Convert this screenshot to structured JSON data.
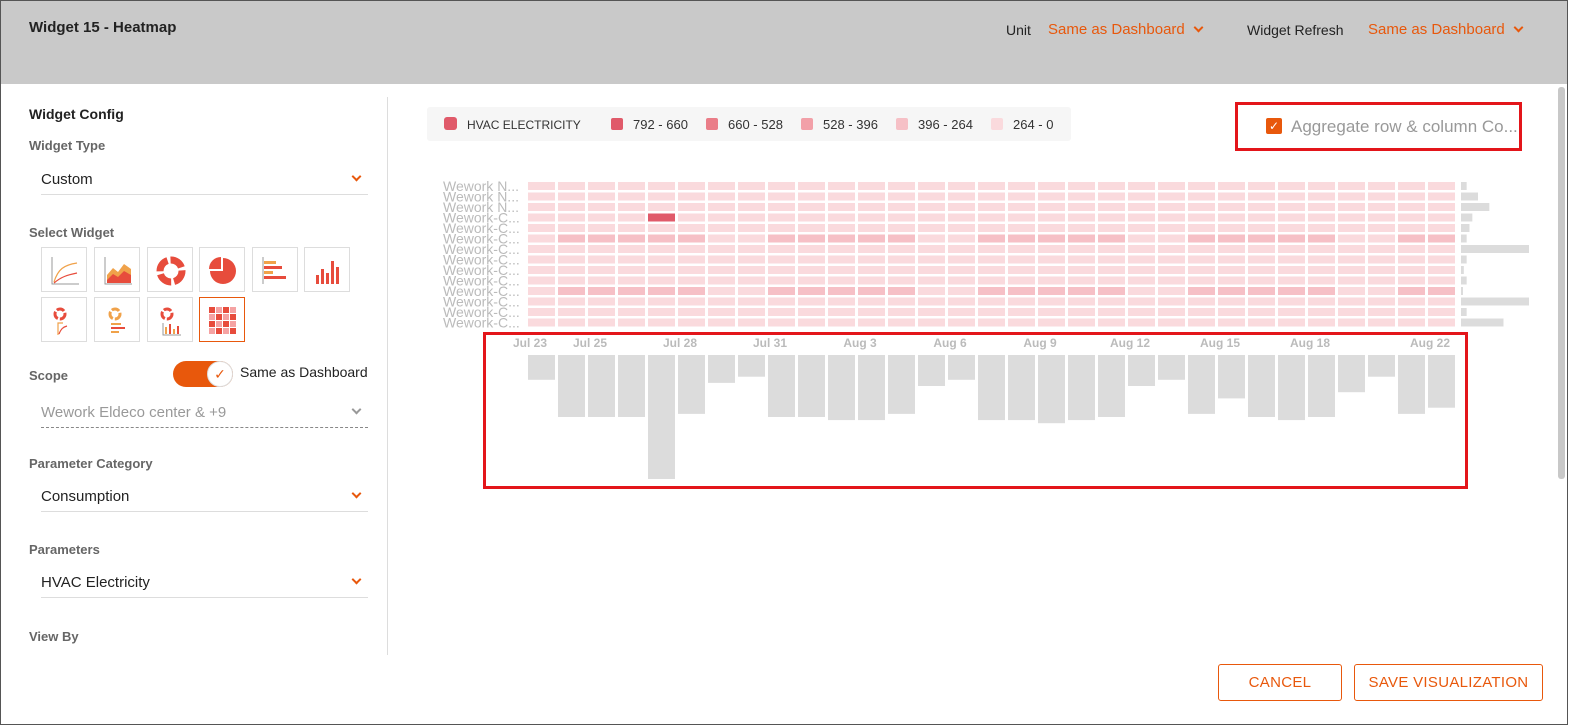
{
  "header": {
    "title": "Widget 15 - Heatmap",
    "unit_label": "Unit",
    "unit_value": "Same as Dashboard",
    "refresh_label": "Widget Refresh",
    "refresh_value": "Same as Dashboard"
  },
  "config": {
    "section_title": "Widget Config",
    "widget_type_label": "Widget Type",
    "widget_type_value": "Custom",
    "select_widget_label": "Select Widget",
    "widget_icons": [
      "line-chart-icon",
      "area-chart-icon",
      "donut-chart-icon",
      "pie-chart-icon",
      "horizontal-bar-chart-icon",
      "column-chart-icon",
      "donut-line-combo-icon",
      "donut-bar-combo-icon",
      "donut-column-combo-icon",
      "heatmap-icon"
    ],
    "selected_widget": "heatmap-icon",
    "scope_label": "Scope",
    "scope_toggle_on": true,
    "scope_toggle_label": "Same as Dashboard",
    "scope_value": "Wework Eldeco center & +9",
    "param_category_label": "Parameter Category",
    "param_category_value": "Consumption",
    "parameters_label": "Parameters",
    "parameters_value": "HVAC Electricity",
    "view_by_label": "View By"
  },
  "legend": {
    "series": "HVAC ELECTRICITY",
    "ranges": [
      {
        "label": "792 - 660",
        "color": "#e05a6a"
      },
      {
        "label": "660 - 528",
        "color": "#ea7d88"
      },
      {
        "label": "528 - 396",
        "color": "#f2a0a8"
      },
      {
        "label": "396 - 264",
        "color": "#f6c0c6"
      },
      {
        "label": "264 - 0",
        "color": "#fadadd"
      }
    ],
    "series_color": "#e05a6a"
  },
  "aggregate": {
    "checked": true,
    "label": "Aggregate row & column Co..."
  },
  "chart_data": {
    "type": "heatmap",
    "rows": [
      "Wework N...",
      "Wework N...",
      "Wework N...",
      "Wework-C...",
      "Wework-C...",
      "Wework-C...",
      "Wework-C...",
      "Wework-C...",
      "Wework-C...",
      "Wework-C...",
      "Wework-C...",
      "Wework-C...",
      "Wework-C...",
      "Wework-C..."
    ],
    "x_ticks": [
      "Jul 23",
      "Jul 25",
      "Jul 28",
      "Jul 31",
      "Aug 3",
      "Aug 6",
      "Aug 9",
      "Aug 12",
      "Aug 15",
      "Aug 18",
      "Aug 22"
    ],
    "columns": 31,
    "intense_cells": [
      [
        3,
        4,
        0
      ]
    ],
    "medium_cells_rows": [
      5,
      10
    ],
    "medium_cols_row5": [
      1,
      2,
      3,
      4,
      5,
      8,
      9,
      10,
      11,
      12,
      15,
      16,
      17,
      18,
      19,
      22,
      23,
      24,
      25,
      26,
      29,
      30
    ],
    "medium_cols_row10": [
      1,
      2,
      3,
      4,
      5,
      8,
      9,
      10,
      11,
      12,
      15,
      16,
      17,
      18,
      19,
      22,
      23,
      24,
      25,
      26,
      29,
      30
    ],
    "row_aggregate": [
      2,
      6,
      10,
      4,
      3,
      2,
      24,
      2,
      1,
      2,
      0.5,
      24,
      2,
      15
    ],
    "column_aggregate": [
      8,
      20,
      20,
      20,
      40,
      19,
      9,
      7,
      20,
      20,
      21,
      21,
      19,
      10,
      8,
      21,
      21,
      22,
      21,
      20,
      10,
      8,
      19,
      14,
      20,
      21,
      20,
      12,
      7,
      19,
      17
    ]
  },
  "buttons": {
    "cancel": "CANCEL",
    "save": "SAVE VISUALIZATION"
  }
}
